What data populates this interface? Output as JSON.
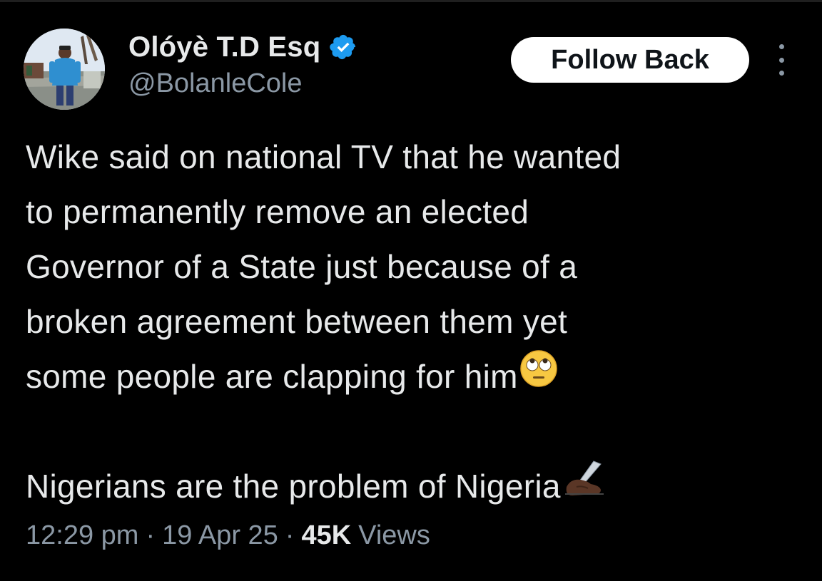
{
  "author": {
    "display_name": "Olóyè T.D Esq",
    "handle": "@BolanleCole",
    "verified": true,
    "avatar_icon": "profile-photo"
  },
  "actions": {
    "follow_label": "Follow Back",
    "more_icon": "more-vertical-icon"
  },
  "tweet": {
    "lines": [
      "Wike said on national TV that he wanted",
      "to permanently remove an elected",
      "Governor of a State just because of a",
      "broken agreement between them yet",
      "some people are clapping for him"
    ],
    "emoji_1": "face-with-rolling-eyes-emoji",
    "line_2": "Nigerians are the problem of Nigeria",
    "emoji_2": "writing-hand-emoji"
  },
  "meta": {
    "time": "12:29 pm",
    "separator": "·",
    "date": "19 Apr 25",
    "views_count": "45K",
    "views_label": "Views"
  },
  "colors": {
    "background": "#000000",
    "primary_text": "#e7e9ea",
    "secondary_text": "#8b98a5",
    "verified_blue": "#1d9bf0",
    "button_bg": "#ffffff",
    "button_text": "#0f1419"
  }
}
